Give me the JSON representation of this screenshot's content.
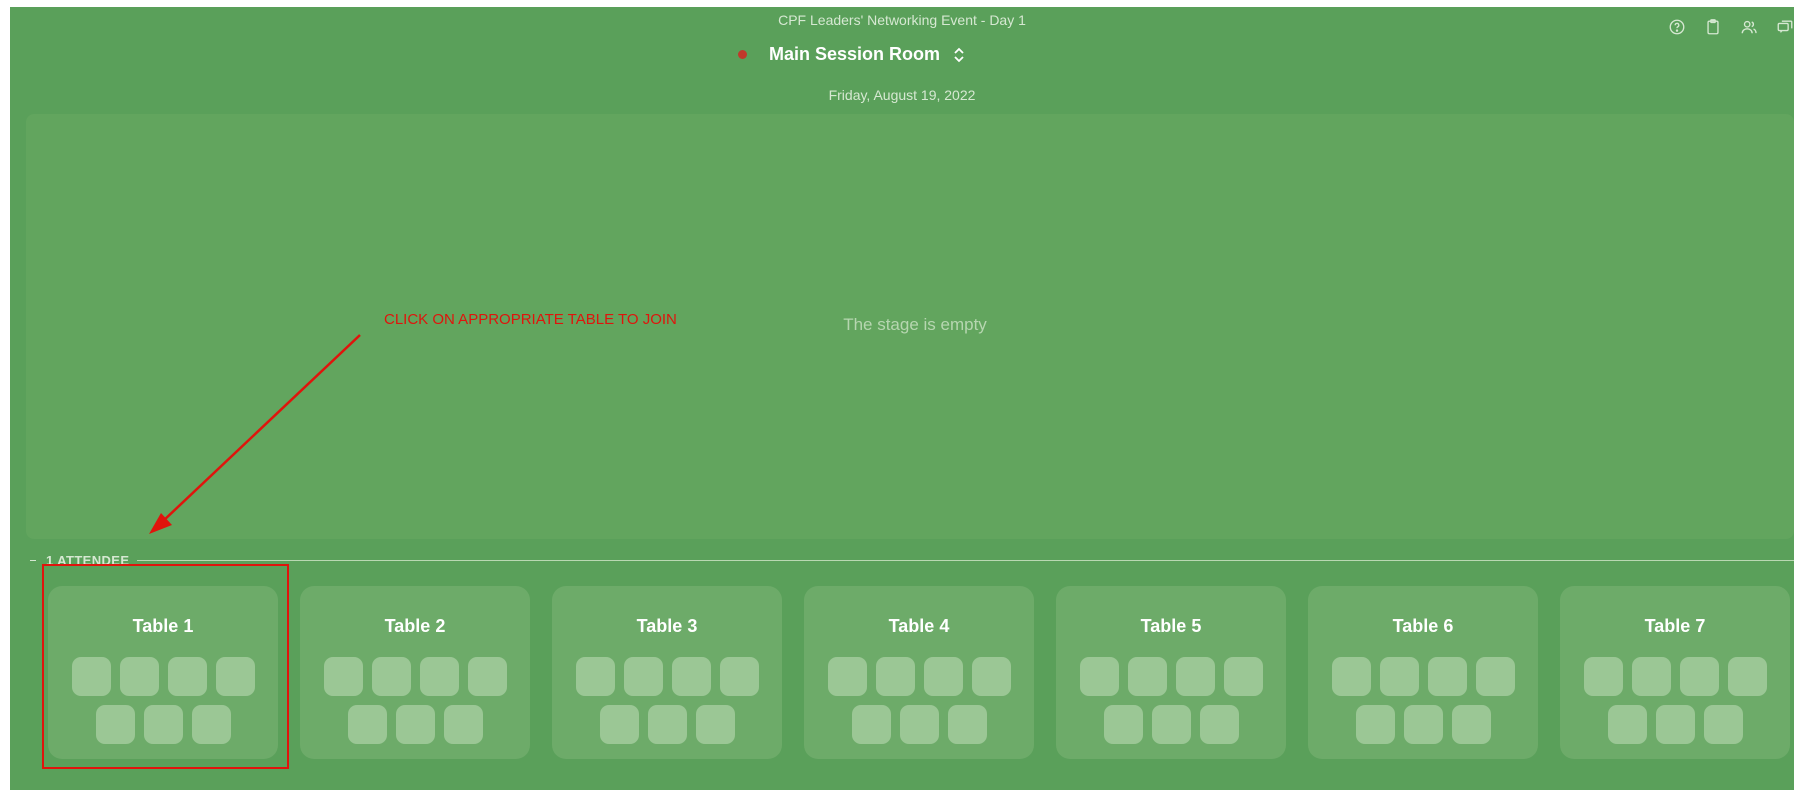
{
  "header": {
    "event_title": "CPF Leaders' Networking Event - Day 1",
    "room_name": "Main Session Room",
    "date": "Friday, August 19, 2022",
    "icons": [
      "help-icon",
      "clipboard-icon",
      "people-icon",
      "chat-icon"
    ]
  },
  "stage": {
    "empty_text": "The stage is empty"
  },
  "annotation": {
    "text": "CLICK ON APPROPRIATE TABLE TO JOIN",
    "color": "#e0140c"
  },
  "attendees": {
    "count_label": "1 ATTENDEE"
  },
  "tables": [
    {
      "name": "Table 1",
      "seats": 7
    },
    {
      "name": "Table 2",
      "seats": 7
    },
    {
      "name": "Table 3",
      "seats": 7
    },
    {
      "name": "Table 4",
      "seats": 7
    },
    {
      "name": "Table 5",
      "seats": 7
    },
    {
      "name": "Table 6",
      "seats": 7
    },
    {
      "name": "Table 7",
      "seats": 7
    }
  ],
  "colors": {
    "background": "#5aa05a",
    "stage": "#62a55e",
    "card": "#6dab69",
    "seat": "#9bc795",
    "live_dot": "#c0392b"
  }
}
